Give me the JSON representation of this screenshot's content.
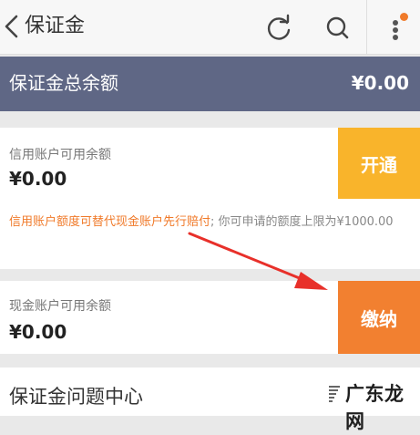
{
  "header": {
    "title": "保证金",
    "back_icon": "chevron-left-icon",
    "refresh_icon": "refresh-icon",
    "search_icon": "search-icon",
    "more_icon": "more-vertical-icon",
    "notification_color": "#f07a2a"
  },
  "total": {
    "label": "保证金总余额",
    "value": "¥0.00",
    "bg_color": "#5f6785"
  },
  "credit": {
    "label": "信用账户可用余额",
    "amount": "¥0.00",
    "button_label": "开通",
    "button_color": "#f9b42b",
    "note_highlight": "信用账户额度可替代现金账户先行赔付",
    "note_rest": "; 你可申请的额度上限为¥1000.00"
  },
  "cash": {
    "label": "现金账户可用余额",
    "amount": "¥0.00",
    "button_label": "缴纳",
    "button_color": "#f28030"
  },
  "help": {
    "title": "保证金问题中心"
  },
  "annotation": {
    "arrow_color": "#e8302a"
  },
  "watermark": {
    "text": "广东龙网"
  }
}
